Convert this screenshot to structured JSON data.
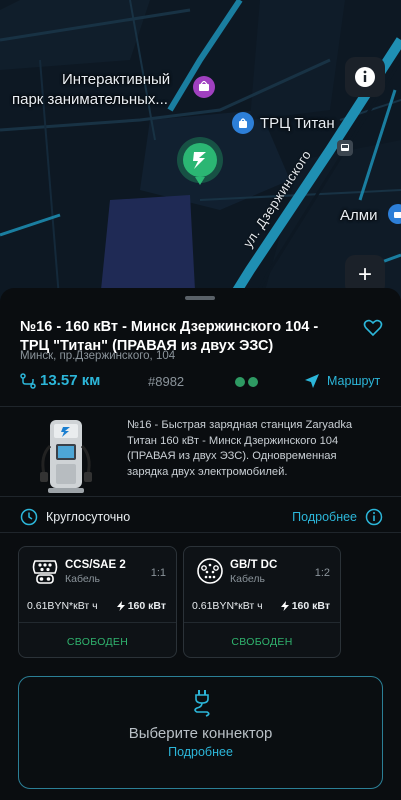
{
  "map": {
    "poi_park_label_line1": "Интерактивный",
    "poi_park_label_line2": "парк занимательных...",
    "poi_mall_label": "ТРЦ Титан",
    "poi_almi_label": "Алми",
    "street_label": "ул. Дзержинского",
    "info_button": "info-icon",
    "zoom_in_label": "+",
    "colors": {
      "road": "#1f8fb3",
      "block": "#1f2a55",
      "pin": "#2bb673"
    }
  },
  "station": {
    "title": "№16 - 160 кВт - Минск Дзержинского 104 - ТРЦ \"Титан\" (ПРАВАЯ из двух ЭЗС)",
    "address": "Минск, пр.Дзержинского, 104",
    "distance": "13.57 км",
    "id": "#8982",
    "route_label": "Маршрут",
    "description": "№16 - Быстрая зарядная станция Zaryadka Титан 160 кВт - Минск Дзержинского 104 (ПРАВАЯ из двух ЭЗС). Одновременная зарядка двух электромобилей.",
    "hours": "Круглосуточно",
    "more_label": "Подробнее"
  },
  "connectors": [
    {
      "name": "CCS/SAE 2",
      "type": "Кабель",
      "qty": "1:1",
      "price": "0.61BYN*кВт ч",
      "power": "160 кВт",
      "status": "СВОБОДЕН",
      "icon": "ccs-connector-icon"
    },
    {
      "name": "GB/T DC",
      "type": "Кабель",
      "qty": "1:2",
      "price": "0.61BYN*кВт ч",
      "power": "160 кВт",
      "status": "СВОБОДЕН",
      "icon": "gbt-connector-icon"
    }
  ],
  "select": {
    "title": "Выберите коннектор",
    "link": "Подробнее"
  },
  "theme": {
    "accent": "#2cb6d9",
    "free": "#30b36e",
    "background": "#0a0d10"
  }
}
